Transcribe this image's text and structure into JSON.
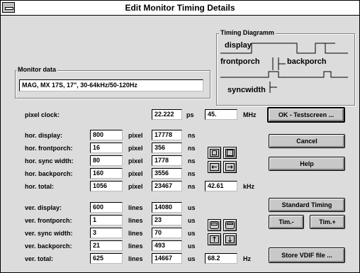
{
  "window": {
    "title": "Edit Monitor Timing Details"
  },
  "timing_diagram": {
    "title": "Timing Diagramm",
    "display_label": "display",
    "frontporch_label": "frontporch",
    "backporch_label": "backporch",
    "syncwidth_label": "syncwidth"
  },
  "monitor_data": {
    "title": "Monitor data",
    "value": "MAG, MX 17S, 17\", 30-64kHz/50-120Hz"
  },
  "pixel_clock": {
    "label": "pixel clock:",
    "ps_value": "22.222",
    "ps_unit": "ps",
    "mhz_value": "45.",
    "mhz_unit": "MHz"
  },
  "horizontal": {
    "rows": [
      {
        "label": "hor. display:",
        "value": "800",
        "unit": "pixel",
        "ns": "17778",
        "ns_unit": "ns"
      },
      {
        "label": "hor. frontporch:",
        "value": "16",
        "unit": "pixel",
        "ns": "356",
        "ns_unit": "ns"
      },
      {
        "label": "hor. sync width:",
        "value": "80",
        "unit": "pixel",
        "ns": "1778",
        "ns_unit": "ns"
      },
      {
        "label": "hor. backporch:",
        "value": "160",
        "unit": "pixel",
        "ns": "3556",
        "ns_unit": "ns"
      },
      {
        "label": "hor. total:",
        "value": "1056",
        "unit": "pixel",
        "ns": "23467",
        "ns_unit": "ns"
      }
    ],
    "freq_value": "42.61",
    "freq_unit": "kHz"
  },
  "vertical": {
    "rows": [
      {
        "label": "ver. display:",
        "value": "600",
        "unit": "lines",
        "us": "14080",
        "us_unit": "us"
      },
      {
        "label": "ver. frontporch:",
        "value": "1",
        "unit": "lines",
        "us": "23",
        "us_unit": "us"
      },
      {
        "label": "ver. sync width:",
        "value": "3",
        "unit": "lines",
        "us": "70",
        "us_unit": "us"
      },
      {
        "label": "ver. backporch:",
        "value": "21",
        "unit": "lines",
        "us": "493",
        "us_unit": "us"
      },
      {
        "label": "ver. total:",
        "value": "625",
        "unit": "lines",
        "us": "14667",
        "us_unit": "us"
      }
    ],
    "freq_value": "68.2",
    "freq_unit": "Hz"
  },
  "buttons": {
    "ok": "OK - Testscreen ...",
    "cancel": "Cancel",
    "help": "Help",
    "standard_timing": "Standard Timing",
    "tim_minus": "Tim.-",
    "tim_plus": "Tim.+",
    "store_vdif": "Store VDIF file ..."
  },
  "icons": [
    "screen-shrink-icon",
    "screen-expand-icon",
    "move-left-icon",
    "move-right-icon",
    "screen-taller-icon",
    "screen-shorter-icon",
    "move-up-icon",
    "move-down-icon"
  ]
}
